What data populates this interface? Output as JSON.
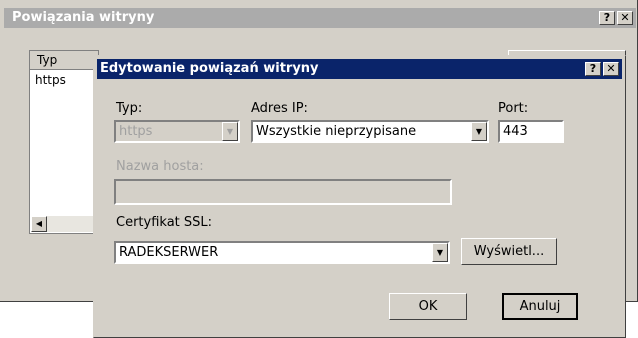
{
  "background_window": {
    "title": "Powiązania witryny",
    "help_label": "?",
    "close_label": "✕",
    "list": {
      "column_header": "Typ",
      "rows": [
        "https"
      ]
    },
    "scroll_left_label": "◀"
  },
  "dialog": {
    "title": "Edytowanie powiązań witryny",
    "help_label": "?",
    "close_label": "✕",
    "type": {
      "label": "Typ:",
      "value": "https"
    },
    "ip": {
      "label": "Adres IP:",
      "value": "Wszystkie nieprzypisane"
    },
    "port": {
      "label": "Port:",
      "value": "443"
    },
    "hostname": {
      "label": "Nazwa hosta:",
      "value": ""
    },
    "ssl": {
      "label": "Certyfikat SSL:",
      "value": "RADEKSERWER",
      "view_label": "Wyświetl..."
    },
    "ok_label": "OK",
    "cancel_label": "Anuluj",
    "dropdown_arrow": "▼"
  },
  "colors": {
    "dialog_title_bar": "#0a246a",
    "inactive_title_bar": "#ababab",
    "face": "#d4d0c8"
  }
}
